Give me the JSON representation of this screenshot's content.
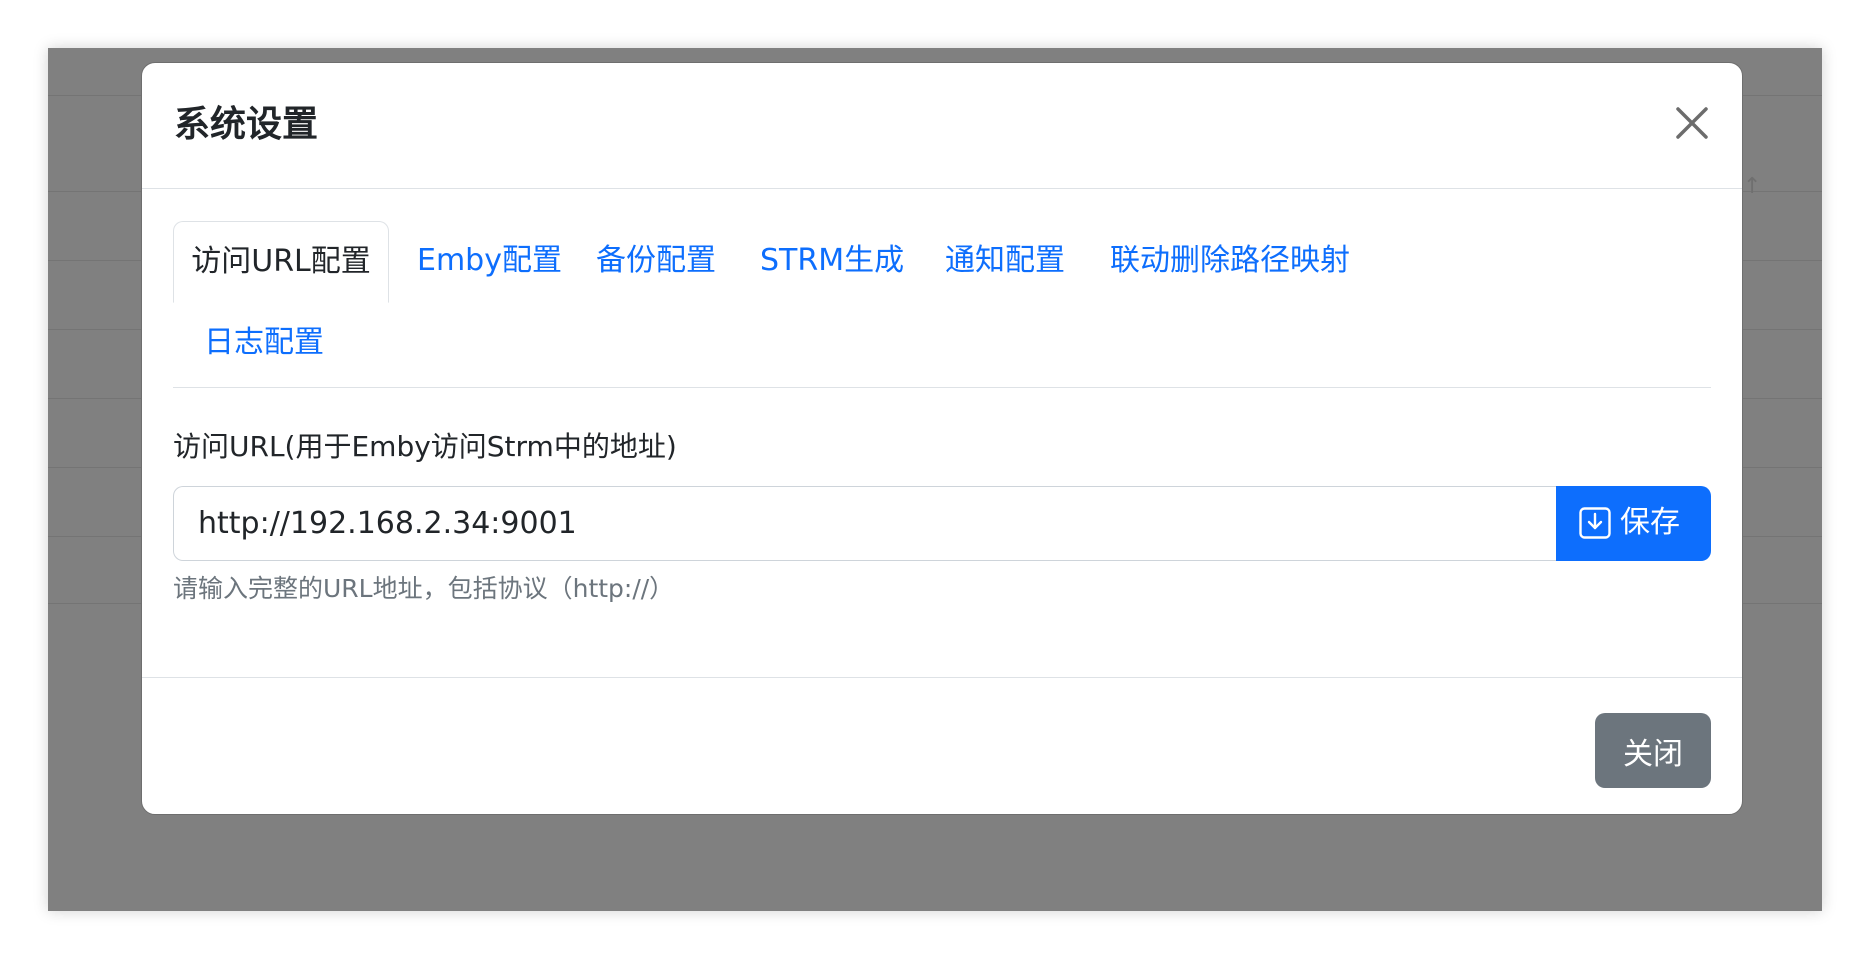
{
  "modal": {
    "title": "系统设置",
    "close_icon": "close-icon"
  },
  "tabs": [
    {
      "label": "访问URL配置",
      "active": true
    },
    {
      "label": "Emby配置",
      "active": false
    },
    {
      "label": "备份配置",
      "active": false
    },
    {
      "label": "STRM生成",
      "active": false
    },
    {
      "label": "通知配置",
      "active": false
    },
    {
      "label": "联动删除路径映射",
      "active": false
    },
    {
      "label": "日志配置",
      "active": false
    }
  ],
  "form": {
    "label": "访问URL(用于Emby访问Strm中的地址)",
    "url_value": "http://192.168.2.34:9001",
    "save_label": "保存",
    "save_icon": "download-save-icon",
    "help": "请输入完整的URL地址，包括协议（http://）"
  },
  "footer": {
    "close_label": "关闭"
  },
  "colors": {
    "primary": "#0d6efd",
    "secondary": "#6c757d",
    "backdrop": "#808080"
  }
}
